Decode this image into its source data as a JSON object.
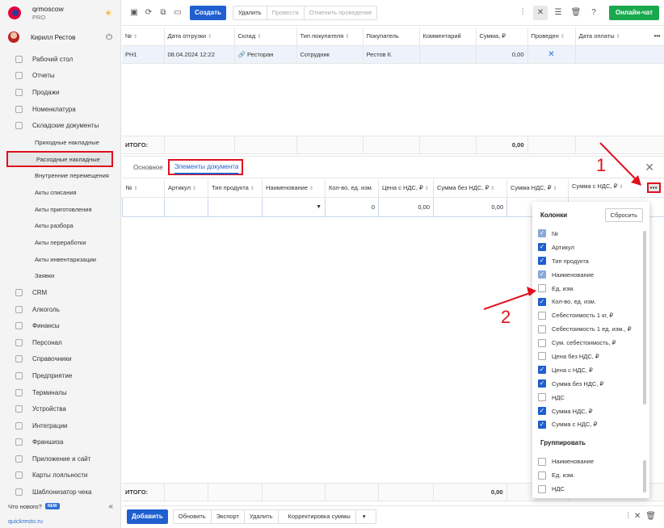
{
  "brand": {
    "name": "qrmoscow",
    "plan": "PRO"
  },
  "user": {
    "name": "Кирилл Рестов"
  },
  "sidebar": {
    "items": [
      {
        "label": "Рабочий стол"
      },
      {
        "label": "Отчеты"
      },
      {
        "label": "Продажи"
      },
      {
        "label": "Номенклатура"
      },
      {
        "label": "Складские документы"
      }
    ],
    "sub_items": [
      {
        "label": "Приходные накладные"
      },
      {
        "label": "Расходные накладные"
      },
      {
        "label": "Внутренние перемещения"
      },
      {
        "label": "Акты списания"
      },
      {
        "label": "Акты приготовления"
      },
      {
        "label": "Акты разбора"
      },
      {
        "label": "Акты переработки"
      },
      {
        "label": "Акты инвентаризации"
      },
      {
        "label": "Заявки"
      }
    ],
    "items2": [
      {
        "label": "CRM"
      },
      {
        "label": "Алкоголь"
      },
      {
        "label": "Финансы"
      },
      {
        "label": "Персонал"
      },
      {
        "label": "Справочники"
      },
      {
        "label": "Предприятие"
      },
      {
        "label": "Терминалы"
      },
      {
        "label": "Устройства"
      },
      {
        "label": "Интеграции"
      },
      {
        "label": "Франшиза"
      },
      {
        "label": "Приложение и сайт"
      },
      {
        "label": "Карты лояльности"
      },
      {
        "label": "Шаблонизатор чека"
      }
    ],
    "whats_new": "Что нового?",
    "new_badge": "NEW",
    "site": "quickresto.ru"
  },
  "toolbar": {
    "create": "Создать",
    "delete": "Удалить",
    "post": "Провести",
    "unpost": "Отменить проведение",
    "chat": "Онлайн-чат"
  },
  "docs_table": {
    "columns": [
      "№",
      "Дата отгрузки",
      "Склад",
      "Тип покупателя",
      "Покупатель",
      "Комментарий",
      "Сумма, ₽",
      "Проведен",
      "Дата оплаты"
    ],
    "row": {
      "num": "РН1",
      "date": "08.04.2024 12:22",
      "warehouse": "Ресторан",
      "buyer_type": "Сотрудник",
      "buyer": "Рестов К.",
      "comment": "",
      "sum": "0,00"
    },
    "total_label": "ИТОГО:",
    "total_sum": "0,00"
  },
  "tabs": {
    "basic": "Основное",
    "elements": "Элементы документа"
  },
  "items_table": {
    "columns": [
      "№",
      "Артикул",
      "Тип продукта",
      "Наименование",
      "Кол-во, ед. изм.",
      "Цена с НДС, ₽",
      "Сумма без НДС, ₽",
      "Сумма НДС, ₽",
      "Сумма с НДС, ₽"
    ],
    "edit_row": {
      "qty": "0",
      "price": "0,00",
      "sum_no_vat": "0,00"
    },
    "total_label": "ИТОГО:",
    "total_sum": "0,00",
    "more": "•••"
  },
  "popup": {
    "title": "Колонки",
    "reset": "Сбросить",
    "columns": [
      {
        "label": "№",
        "state": "disabled"
      },
      {
        "label": "Артикул",
        "state": "on"
      },
      {
        "label": "Тип продукта",
        "state": "on"
      },
      {
        "label": "Наименование",
        "state": "disabled"
      },
      {
        "label": "Ед. изм.",
        "state": "off"
      },
      {
        "label": "Кол-во, ед. изм.",
        "state": "on"
      },
      {
        "label": "Себестоимость 1 кг, ₽",
        "state": "off"
      },
      {
        "label": "Себестоимость 1 ед. изм., ₽",
        "state": "off"
      },
      {
        "label": "Сум. себестоимость, ₽",
        "state": "off"
      },
      {
        "label": "Цена без НДС, ₽",
        "state": "off"
      },
      {
        "label": "Цена с НДС, ₽",
        "state": "on"
      },
      {
        "label": "Сумма без НДС, ₽",
        "state": "on"
      },
      {
        "label": "НДС",
        "state": "off"
      },
      {
        "label": "Сумма НДС, ₽",
        "state": "on"
      },
      {
        "label": "Сумма с НДС, ₽",
        "state": "on"
      }
    ],
    "group_title": "Группировать",
    "group": [
      {
        "label": "Наименование",
        "state": "off"
      },
      {
        "label": "Ед. изм.",
        "state": "off"
      },
      {
        "label": "НДС",
        "state": "off"
      }
    ]
  },
  "bottombar": {
    "add": "Добавить",
    "refresh": "Обновить",
    "export": "Экспорт",
    "delete": "Удалить",
    "adjust": "Корректировка суммы"
  },
  "annotations": {
    "one": "1",
    "two": "2"
  },
  "colors": {
    "accent": "#1f5fcf",
    "highlight": "#e0101e",
    "chat": "#1aa84f"
  }
}
